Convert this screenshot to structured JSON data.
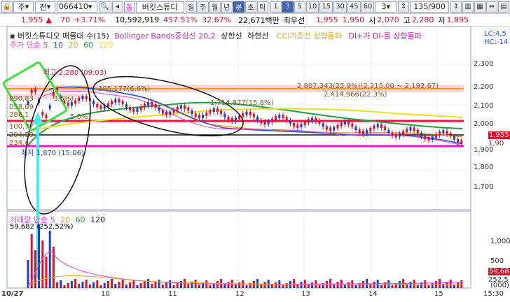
{
  "toolbar": {
    "type_label": "주",
    "prev_label": "전",
    "code": "066410",
    "name": "버킷스튜디",
    "periods": [
      "일",
      "주",
      "월",
      "년",
      "분",
      "초",
      "틱"
    ],
    "active_period": "분",
    "intervals": [
      "1",
      "3",
      "5",
      "10",
      "15",
      "30",
      "45",
      "60"
    ],
    "active_interval": "3",
    "interval_value": "3",
    "page_count": "135/900"
  },
  "info": {
    "price": "1,955",
    "change_arrow": "▲",
    "change": "70",
    "change_pct": "+3.71%",
    "volume": "10,592,919",
    "volume_pct": "457.51%",
    "turnover": "32.67%",
    "amount": "22,671백만",
    "best_label": "최우선",
    "best_ask": "1,955",
    "best_bid": "1,950",
    "open_label": "시",
    "open": "2,070",
    "high_label": "고",
    "high": "2,280",
    "low_label": "저",
    "low": "1,895"
  },
  "legend_top": {
    "title": "버킷스튜디오 매물대 수(15)",
    "bollinger": "Bollinger Bands중심선 20,2",
    "upper": "상한선",
    "lower": "하한선",
    "cci": "CCI기준선 상향돌파",
    "di": "DI+가 DI-를 상향돌파",
    "ma_label": "주가 단순 5",
    "ma10": "10",
    "ma20": "20",
    "ma60": "60",
    "ma120": "120",
    "right_lc": "LC:4,5",
    "right_hc": "HC:-14"
  },
  "annotations": {
    "high_mark": "최고 2,280 (09:03)",
    "vol_profile_1": "2,807,343(25.9%)(2,215.00 ~ 2,192.67)",
    "vol_profile_2": "2,414,966(22.3%)",
    "vol_profile_3": "1,714,877(15.8%)",
    "vol_profile_4": "305,177(6.6%)",
    "left_1": "890,83",
    "left_1b": "3.6%)",
    "left_2": "058,09",
    "left_3": "286,1",
    "left_3b": "5.0%)",
    "left_4": "100,77",
    "left_5": "294,59",
    "left_6": "234,4",
    "low_mark": "최저 1,870 (15:06)"
  },
  "legend_vol": {
    "label": "거래량 단순 5",
    "v20": "20",
    "v60": "60",
    "v120": "120",
    "max_vol": "59,682",
    "max_pct": "(252,52%)"
  },
  "price_axis": [
    "2,300",
    "2,200",
    "2,100",
    "2,000",
    "1,955",
    "1,900",
    "1,800",
    "1,700"
  ],
  "price_axis_extra": "1,90",
  "vol_axis": [
    "1,000",
    "500",
    "59,68",
    "252,5"
  ],
  "vol_axis_unit": "(000)",
  "time_axis": [
    "10/27",
    "10",
    "11",
    "12",
    "13",
    "14",
    "15",
    "15:30"
  ],
  "colors": {
    "up": "#e0102a",
    "down": "#1a3fd0",
    "ma5": "#e040e0",
    "ma10": "#2050e0",
    "ma20": "#f0a020",
    "ma60": "#20a040",
    "ma120": "#e8e020",
    "magenta_line": "#ff10d0",
    "red_line": "#ff1040",
    "green_box": "#40e040",
    "cyan_arrow": "#40f0f0"
  }
}
